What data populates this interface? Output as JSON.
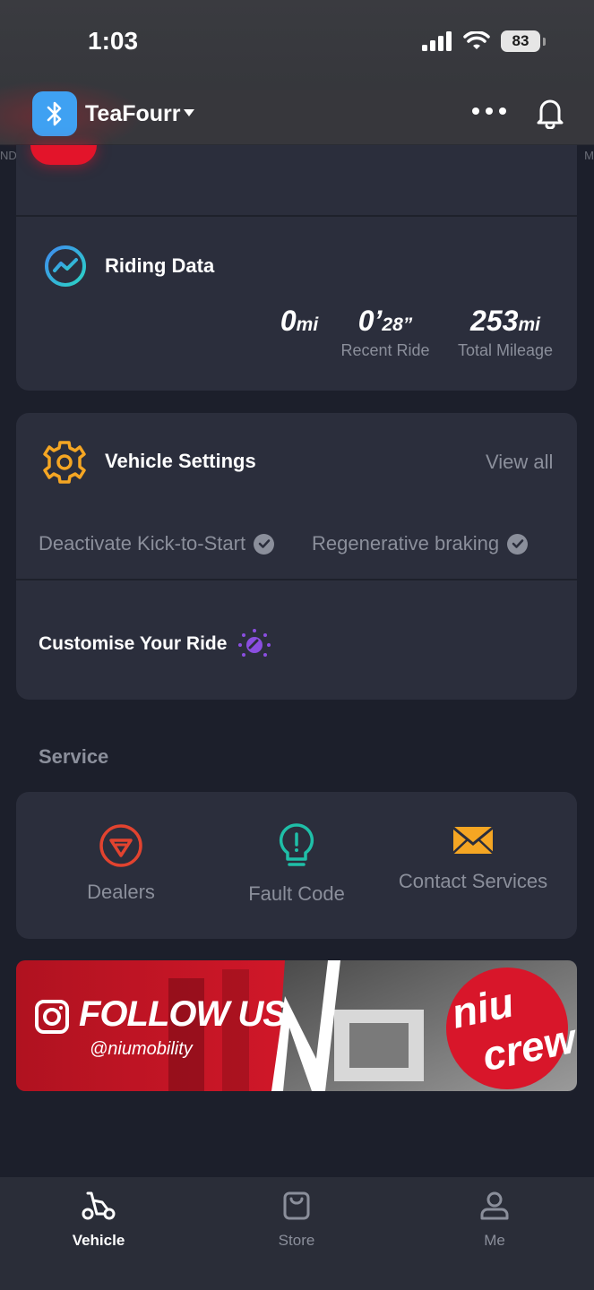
{
  "status_bar": {
    "time": "1:03",
    "battery": "83"
  },
  "header": {
    "vehicle_name": "TeaFourr",
    "edge_left": "ND",
    "edge_right": "M"
  },
  "riding_data": {
    "title": "Riding Data",
    "stats": [
      {
        "value": "0",
        "unit": "mi",
        "label": ""
      },
      {
        "value": "0’",
        "unit": "28”",
        "label": "Recent Ride"
      },
      {
        "value": "253",
        "unit": "mi",
        "label": "Total Mileage"
      }
    ]
  },
  "vehicle_settings": {
    "title": "Vehicle Settings",
    "view_all": "View all",
    "chips": [
      "Deactivate Kick-to-Start",
      "Regenerative braking"
    ],
    "customise": "Customise Your Ride"
  },
  "service": {
    "heading": "Service",
    "items": [
      {
        "label": "Dealers",
        "icon": "dealer-shield-icon",
        "color": "#e2432f"
      },
      {
        "label": "Fault Code",
        "icon": "lightbulb-icon",
        "color": "#1fbfa8"
      },
      {
        "label": "Contact Services",
        "icon": "envelope-icon",
        "color": "#f5a623"
      }
    ]
  },
  "banner": {
    "follow": "FOLLOW US",
    "handle": "@niumobility",
    "brand_line1": "niu",
    "brand_line2": "crew"
  },
  "tabs": [
    {
      "label": "Vehicle",
      "icon": "scooter-icon",
      "active": true
    },
    {
      "label": "Store",
      "icon": "shopping-bag-icon",
      "active": false
    },
    {
      "label": "Me",
      "icon": "person-icon",
      "active": false
    }
  ],
  "colors": {
    "background": "#1c1f2b",
    "card": "#2b2e3c",
    "accent_red": "#e3142a",
    "bluetooth": "#3fa1f2",
    "gear": "#f5a623",
    "customise": "#8a4ee0"
  }
}
